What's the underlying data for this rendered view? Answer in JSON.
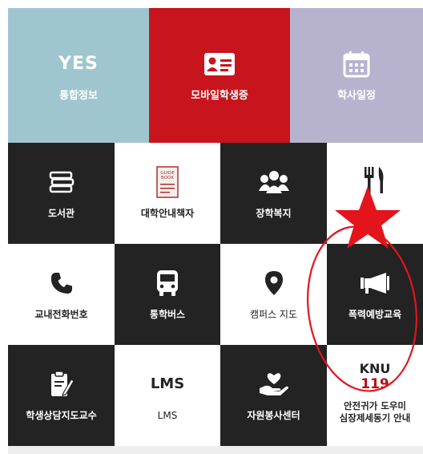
{
  "top": [
    {
      "title": "YES",
      "label": "통합정보",
      "icon": "yes-logo",
      "bg": "#9fc6cf"
    },
    {
      "label": "모바일학생증",
      "icon": "id-card-icon",
      "bg": "#c8141d"
    },
    {
      "label": "학사일정",
      "icon": "calendar-icon",
      "bg": "#b7b3cf"
    }
  ],
  "row2": [
    {
      "label": "도서관",
      "icon": "books-icon"
    },
    {
      "label": "대학안내책자",
      "icon": "guide-book-icon",
      "book_text": "GUIDE BOOK"
    },
    {
      "label": "장학복지",
      "icon": "people-group-icon"
    },
    {
      "label": "",
      "icon": "utensils-icon"
    }
  ],
  "row3": [
    {
      "label": "교내전화번호",
      "icon": "phone-icon"
    },
    {
      "label": "통학버스",
      "icon": "bus-icon"
    },
    {
      "label": "캠퍼스 지도",
      "icon": "map-pin-icon"
    },
    {
      "label": "폭력예방교육",
      "icon": "megaphone-icon"
    }
  ],
  "row4": [
    {
      "label": "학생상담지도교수",
      "icon": "clipboard-pen-icon"
    },
    {
      "label": "LMS",
      "title": "LMS"
    },
    {
      "label": "자원봉사센터",
      "icon": "hand-heart-icon"
    },
    {
      "knu": "KNU",
      "number": "119",
      "line1": "안전귀가 도우미",
      "line2": "심장제세동기 안내"
    }
  ],
  "annotation": {
    "shapes": [
      "red-star",
      "red-circle"
    ],
    "color": "#e3141b"
  }
}
